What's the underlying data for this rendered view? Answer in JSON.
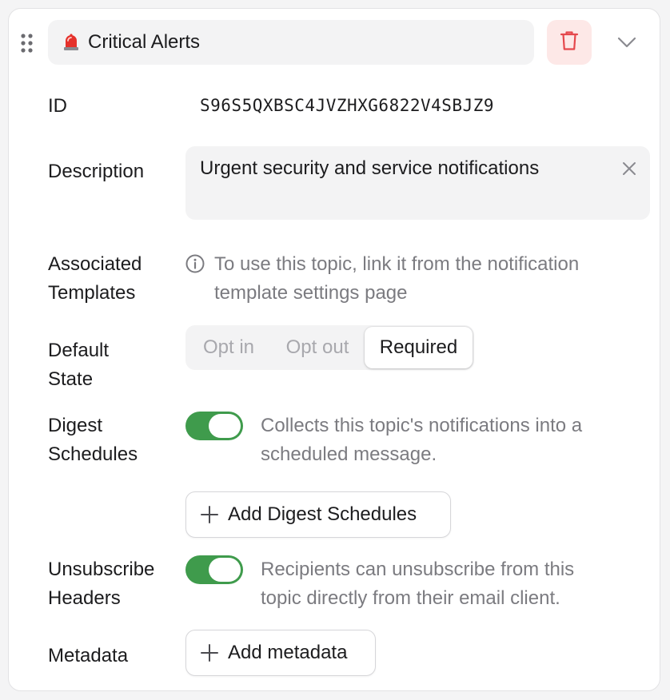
{
  "topic": {
    "title": "Critical Alerts"
  },
  "fields": {
    "id": {
      "label": "ID",
      "value": "S96S5QXBSC4JVZHXG6822V4SBJZ9"
    },
    "description": {
      "label": "Description",
      "value": "Urgent security and service notifications"
    },
    "associated_templates": {
      "label_line1": "Associated",
      "label_line2": "Templates",
      "info_line1": "To use this topic, link it from the notification",
      "info_line2": "template settings page"
    },
    "default_state": {
      "label_line1": "Default",
      "label_line2": "State",
      "options": [
        "Opt in",
        "Opt out",
        "Required"
      ],
      "selected": "Required"
    },
    "digest_schedules": {
      "label_line1": "Digest",
      "label_line2": "Schedules",
      "enabled": true,
      "help_line1": "Collects this topic's notifications into a",
      "help_line2": "scheduled message.",
      "add_button": "Add Digest Schedules"
    },
    "unsubscribe_headers": {
      "label_line1": "Unsubscribe",
      "label_line2": "Headers",
      "enabled": true,
      "help_line1": "Recipients can unsubscribe from this",
      "help_line2": "topic directly from their email client."
    },
    "metadata": {
      "label": "Metadata",
      "add_button": "Add metadata"
    }
  },
  "icons": {
    "drag": "drag-handle-icon",
    "siren": "siren-icon",
    "delete": "trash-icon",
    "expand": "chevron-down-icon",
    "clear": "close-icon",
    "info": "info-icon",
    "add": "plus-icon"
  },
  "colors": {
    "toggle_on": "#3f9b4c",
    "delete_bg": "#fde8e7",
    "delete_icon": "#e5484d",
    "muted_text": "#7b7b80"
  }
}
